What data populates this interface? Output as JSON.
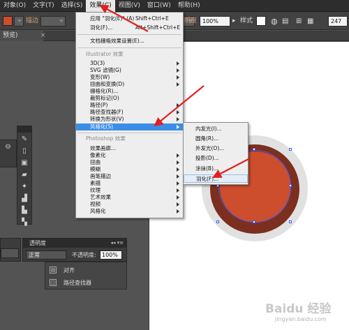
{
  "menubar": {
    "items": [
      "对象(O)",
      "文字(T)",
      "选择(S)",
      "效果(C)",
      "视图(V)",
      "窗口(W)",
      "帮助(H)"
    ],
    "active_index": 3
  },
  "control_bar": {
    "stroke_label": "描边",
    "opacity_label": "明度",
    "opacity_value": "100%",
    "style_label": "样式",
    "width_value": "247"
  },
  "doc_tab": {
    "label": "预览)",
    "close": "×"
  },
  "effect_menu": {
    "apply_last": {
      "label": "应用 \"羽化(E)\" (A)",
      "shortcut": "Shift+Ctrl+E"
    },
    "last_effect": {
      "label": "羽化(F)...",
      "shortcut": "Alt+Shift+Ctrl+E"
    },
    "doc_raster_settings": "文档栅格效果设置(E)...",
    "illustrator_header": "Illustrator 效果",
    "illustrator_items": [
      {
        "label": "3D(3)",
        "submenu": true
      },
      {
        "label": "SVG 滤镜(G)",
        "submenu": true
      },
      {
        "label": "变形(W)",
        "submenu": true
      },
      {
        "label": "扭曲和变换(D)",
        "submenu": true
      },
      {
        "label": "栅格化(R)...",
        "submenu": false
      },
      {
        "label": "裁剪标记(O)",
        "submenu": false
      },
      {
        "label": "路径(P)",
        "submenu": true
      },
      {
        "label": "路径查找器(F)",
        "submenu": true
      },
      {
        "label": "转换为形状(V)",
        "submenu": true
      },
      {
        "label": "风格化(S)",
        "submenu": true
      }
    ],
    "highlighted_index": 9,
    "photoshop_header": "Photoshop 效果",
    "photoshop_items": [
      {
        "label": "效果画廊...",
        "submenu": false
      },
      {
        "label": "像素化",
        "submenu": true
      },
      {
        "label": "扭曲",
        "submenu": true
      },
      {
        "label": "模糊",
        "submenu": true
      },
      {
        "label": "画笔描边",
        "submenu": true
      },
      {
        "label": "素描",
        "submenu": true
      },
      {
        "label": "纹理",
        "submenu": true
      },
      {
        "label": "艺术效果",
        "submenu": true
      },
      {
        "label": "视频",
        "submenu": true
      },
      {
        "label": "风格化",
        "submenu": true
      }
    ]
  },
  "stylize_submenu": {
    "items": [
      "内发光(I)...",
      "圆角(R)...",
      "外发光(O)...",
      "投影(D)...",
      "涂抹(B)...",
      "羽化(F)..."
    ],
    "highlighted_index": 5
  },
  "transparency_panel": {
    "title": "透明度",
    "header_controls": "◂◂ ▾≡",
    "blend_mode": "正常",
    "opacity_label": "不透明度:",
    "opacity_value": "100%"
  },
  "panel_list": {
    "items": [
      "对齐",
      "路径查找器"
    ]
  },
  "artwork": {
    "outer_color": "#7c2f1f",
    "inner_color": "#cc4e2d",
    "shadow_color": "#e1e1e1",
    "selection_color": "#3f5df5"
  },
  "annotation_color": "#e02020",
  "watermark": {
    "line1": "Baidu 经验",
    "line2": "jingyan.baidu.com"
  }
}
